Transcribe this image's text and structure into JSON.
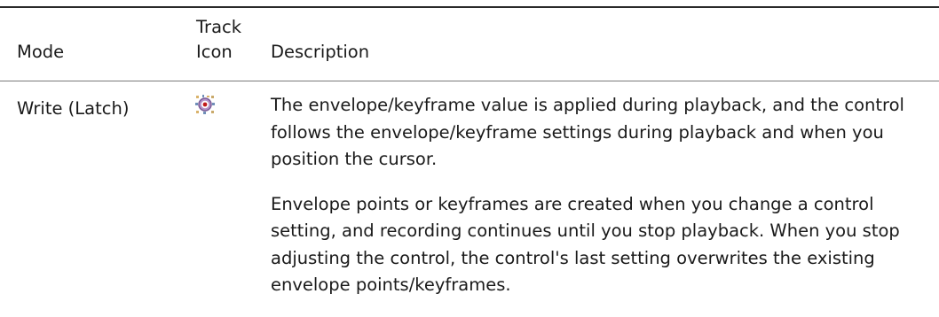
{
  "table": {
    "headers": {
      "mode": "Mode",
      "track_icon": "Track Icon",
      "description": "Description"
    },
    "rows": [
      {
        "mode": "Write (Latch)",
        "icon": "write-latch-track-icon",
        "description": [
          "The envelope/keyframe value is applied during playback, and the control follows the envelope/keyframe settings during playback and when you position the cursor.",
          "Envelope points or keyframes are created when you change a control setting, and recording continues until you stop playback. When you stop adjusting the control, the control's last setting overwrites the existing envelope points/keyframes."
        ]
      }
    ]
  }
}
